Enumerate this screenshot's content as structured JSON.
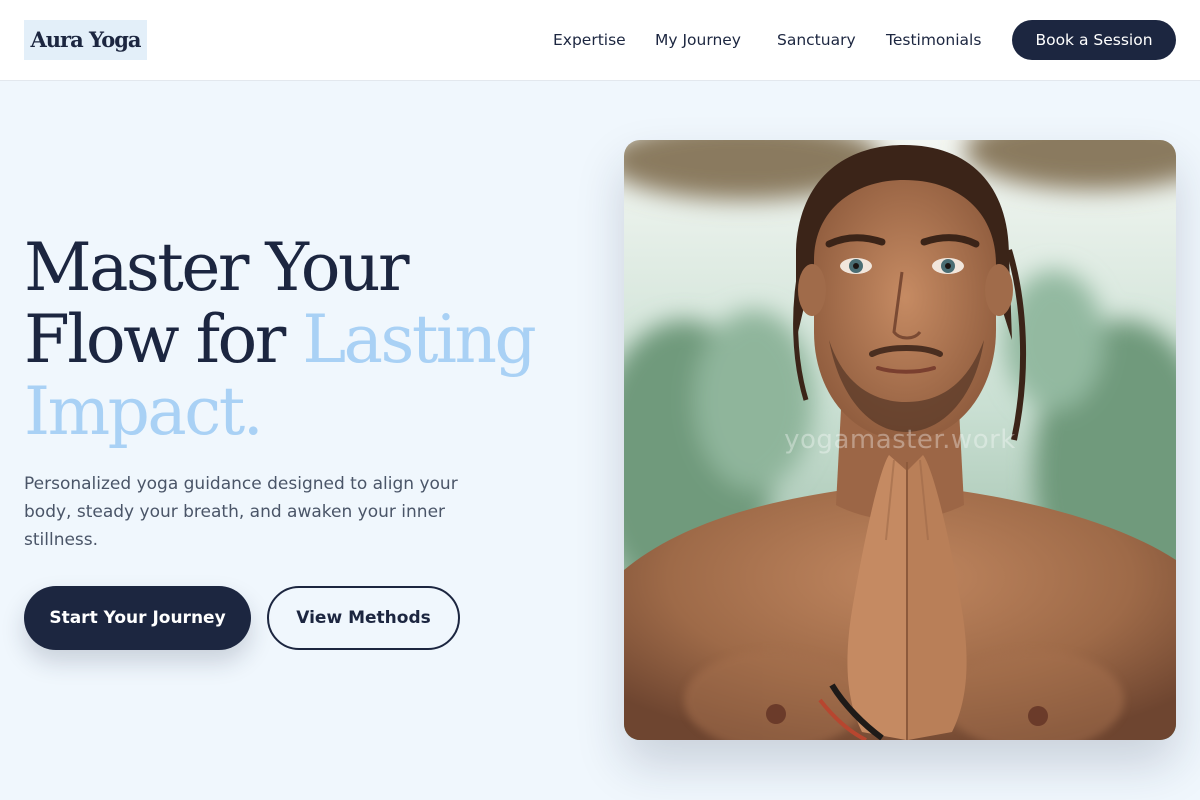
{
  "brand": {
    "logo_text": "Aura Yoga"
  },
  "nav": {
    "links": [
      "Expertise",
      "My Journey",
      "Sanctuary",
      "Testimonials"
    ],
    "cta_label": "Book a Session"
  },
  "hero": {
    "title_line1": "Master Your",
    "title_line2_plain": "Flow for ",
    "title_line2_accent": "Lasting",
    "title_line3_accent": "Impact.",
    "description": "Personalized yoga guidance designed to align your body, steady your breath, and awaken your inner stillness.",
    "primary_cta": "Start Your Journey",
    "secondary_cta": "View Methods",
    "image_watermark": "yogamaster.work"
  },
  "colors": {
    "navy": "#1c2640",
    "accent_blue": "#a9d1f5",
    "page_background": "#f0f7fd",
    "logo_background": "#e3eff9"
  },
  "icons": {
    "hero_image": "yoga-teacher-namaste-portrait"
  }
}
